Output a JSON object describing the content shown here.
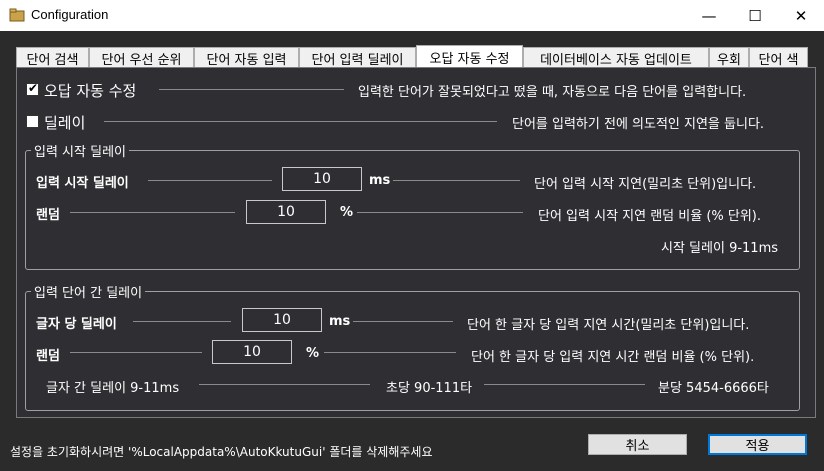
{
  "window": {
    "title": "Configuration",
    "minimize": "—",
    "maximize": "☐",
    "close": "✕"
  },
  "tabs": [
    {
      "label": "단어 검색"
    },
    {
      "label": "단어 우선 순위"
    },
    {
      "label": "단어 자동 입력"
    },
    {
      "label": "단어 입력 딜레이"
    },
    {
      "label": "오답 자동 수정"
    },
    {
      "label": "데이터베이스 자동 업데이트"
    },
    {
      "label": "우회"
    },
    {
      "label": "단어 색"
    }
  ],
  "active_tab_index": 4,
  "options": {
    "auto_fix": {
      "label": "오답 자동 수정",
      "checked": true,
      "description": "입력한 단어가 잘못되었다고 떴을 때, 자동으로 다음 단어를 입력합니다."
    },
    "delay": {
      "label": "딜레이",
      "checked": false,
      "description": "단어를 입력하기 전에 의도적인 지연을 둡니다."
    }
  },
  "start_delay_group": {
    "title": "입력 시작 딜레이",
    "delay_label": "입력 시작 딜레이",
    "delay_value": "10",
    "delay_unit": "ms",
    "delay_description": "단어 입력 시작 지연(밀리초 단위)입니다.",
    "random_label": "랜덤",
    "random_value": "10",
    "random_unit": "%",
    "random_description": "단어 입력 시작 지연 랜덤 비율 (% 단위).",
    "summary": "시작 딜레이 9-11ms"
  },
  "char_delay_group": {
    "title": "입력 단어 간 딜레이",
    "delay_label": "글자 당 딜레이",
    "delay_value": "10",
    "delay_unit": "ms",
    "delay_description": "단어 한 글자 당 입력 지연 시간(밀리초 단위)입니다.",
    "random_label": "랜덤",
    "random_value": "10",
    "random_unit": "%",
    "random_description": "단어 한 글자 당 입력 지연 시간 랜덤 비율 (% 단위).",
    "summary_char": "글자 간 딜레이 9-11ms",
    "summary_sec": "초당 90-111타",
    "summary_min": "분당 5454-6666타"
  },
  "footer": {
    "reset_hint": "설정을 초기화하시려면 '%LocalAppdata%\\AutoKkutuGui' 폴더를 삭제해주세요",
    "cancel_label": "취소",
    "apply_label": "적용"
  }
}
